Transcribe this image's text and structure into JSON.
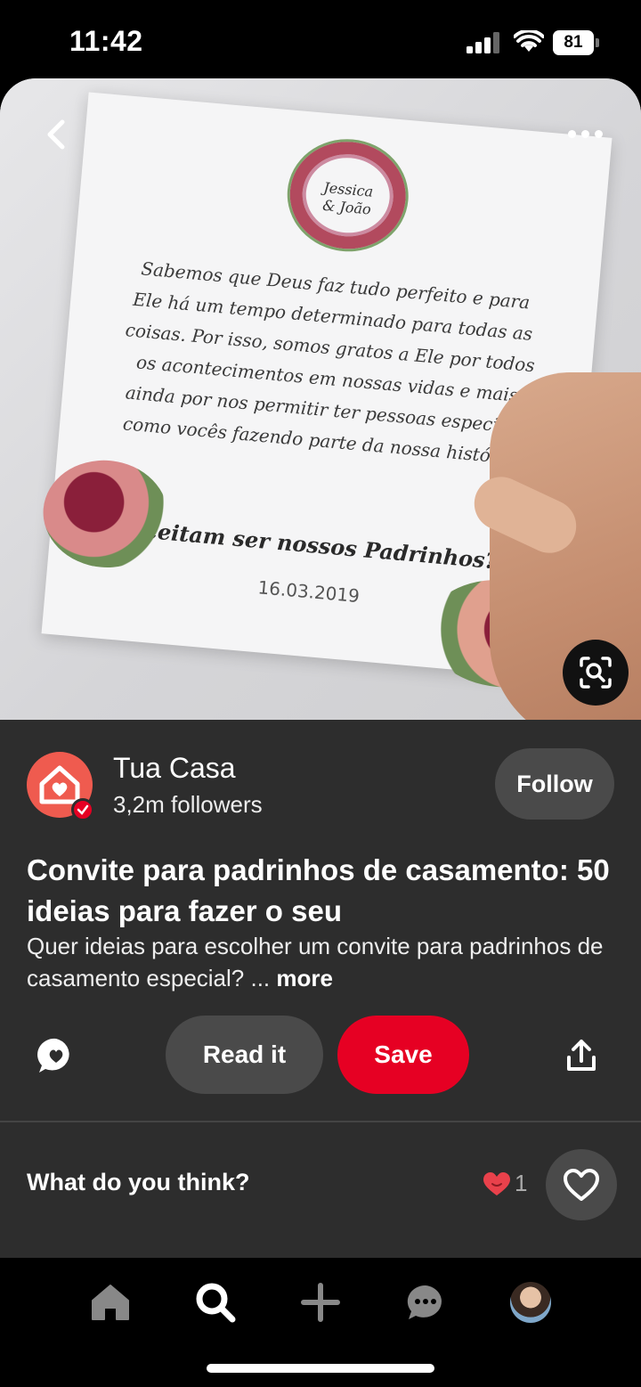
{
  "status_bar": {
    "time": "11:42",
    "battery": "81"
  },
  "pin_image": {
    "card": {
      "names_line1": "Jessica",
      "names_line2": "& João",
      "message": "Sabemos que Deus faz tudo perfeito e para Ele há um tempo determinado para todas as coisas. Por isso, somos gratos a Ele por todos os acontecimentos em nossas vidas e mais ainda por nos permitir ter pessoas especiais como vocês fazendo parte da nossa história.",
      "call_to_action": "Aceitam ser nossos Padrinhos?",
      "date": "16.03.2019"
    },
    "icons": {
      "back": "chevron-left-icon",
      "more": "more-dots-icon",
      "lens": "visual-search-icon"
    }
  },
  "creator": {
    "name": "Tua Casa",
    "followers": "3,2m followers",
    "follow_label": "Follow"
  },
  "pin": {
    "title": "Convite para padrinhos de casamento: 50 ideias para fazer o seu",
    "description": "Quer ideias para escolher um convite para padrinhos de casamento especial? ...",
    "more_label": "more"
  },
  "actions": {
    "read_label": "Read it",
    "save_label": "Save"
  },
  "feedback": {
    "prompt": "What do you think?",
    "reaction_count": "1"
  },
  "colors": {
    "save_red": "#e60023",
    "panel_bg": "#2d2d2d",
    "avatar_bg": "#ef5b4f"
  }
}
